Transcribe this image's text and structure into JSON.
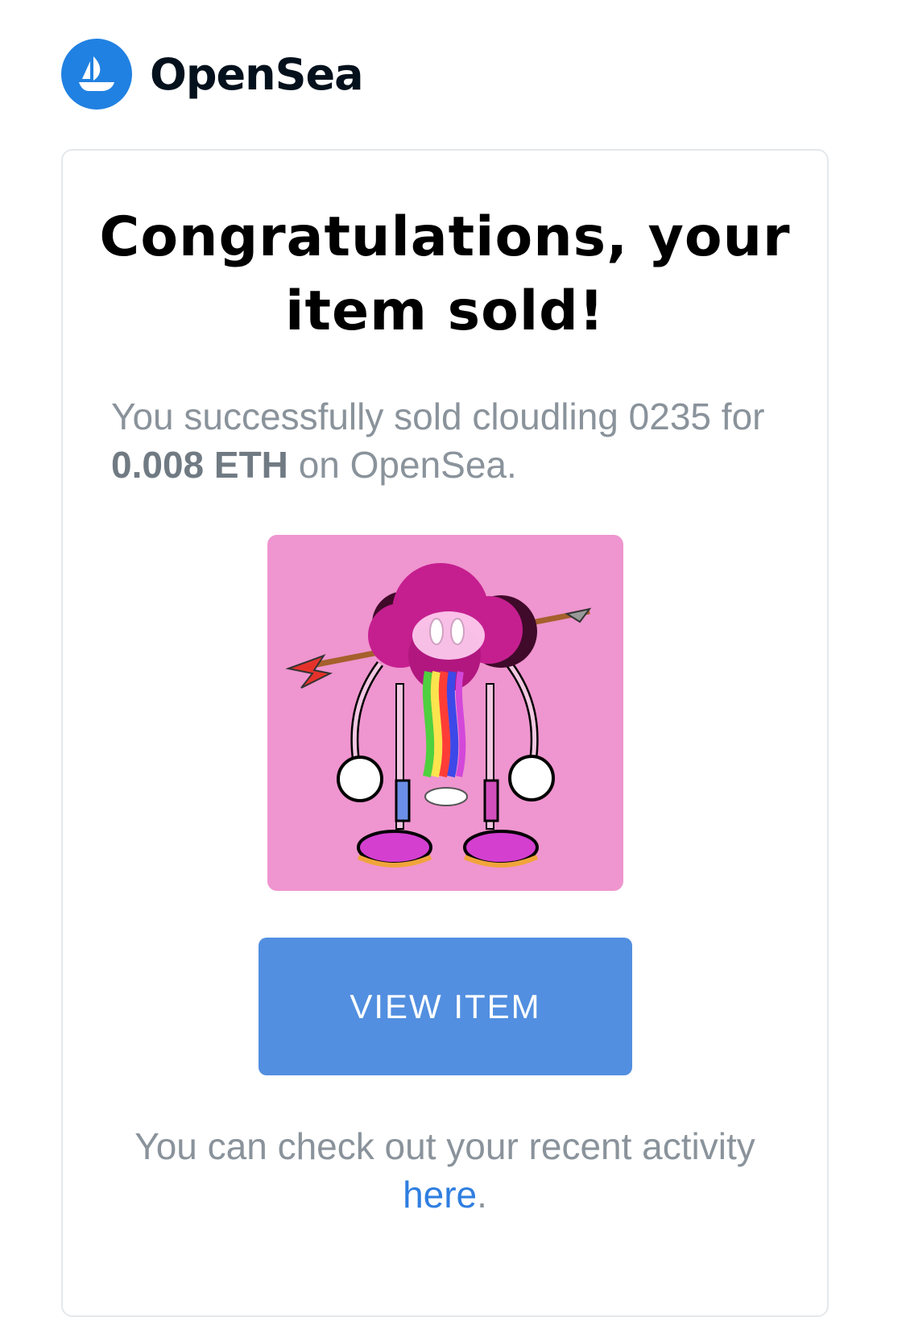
{
  "brand": {
    "name": "OpenSea",
    "logo_icon": "opensea-ship-icon",
    "accent_color": "#2081e2"
  },
  "email": {
    "headline_line1": "Congratulations, your",
    "headline_line2": "item sold!",
    "message_prefix": "You successfully sold cloudling 0235 for",
    "price": "0.008 ETH",
    "message_suffix": "on OpenSea.",
    "item_image_icon": "cloudling-nft-artwork",
    "view_button_label": "VIEW ITEM",
    "button_color": "#528fe0",
    "footer_text": "You can check out your recent activity",
    "footer_link": "here",
    "footer_end": "."
  }
}
